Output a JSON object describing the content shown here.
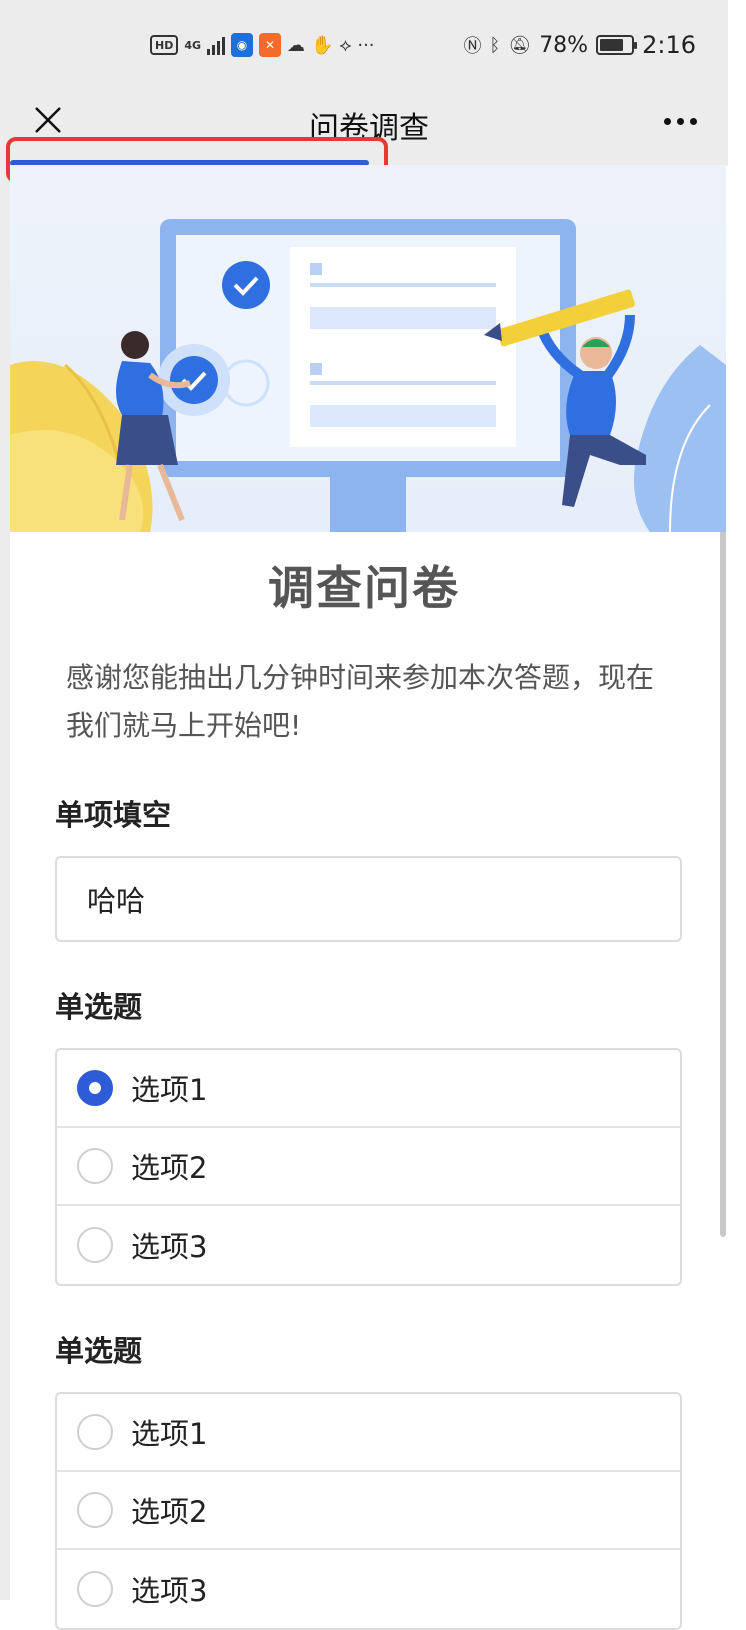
{
  "status_bar": {
    "hd": "HD",
    "network": "4G",
    "battery_percent": "78%",
    "battery_level": 0.78,
    "time": "2:16",
    "more": "···"
  },
  "nav": {
    "title": "问卷调查"
  },
  "progress": {
    "fraction": 0.5,
    "color": "#2f5bd6",
    "highlight_color": "#e53935"
  },
  "survey": {
    "title": "调查问卷",
    "description": "感谢您能抽出几分钟时间来参加本次答题，现在我们就马上开始吧!",
    "questions": [
      {
        "label": "单项填空",
        "type": "fill",
        "value": "哈哈"
      },
      {
        "label": "单选题",
        "type": "radio",
        "options": [
          "选项1",
          "选项2",
          "选项3"
        ],
        "selected_index": 0
      },
      {
        "label": "单选题",
        "type": "radio",
        "options": [
          "选项1",
          "选项2",
          "选项3"
        ],
        "selected_index": -1
      }
    ]
  },
  "colors": {
    "accent": "#2f5bd6",
    "bar_bg": "#ececec",
    "text_muted": "#555555"
  }
}
